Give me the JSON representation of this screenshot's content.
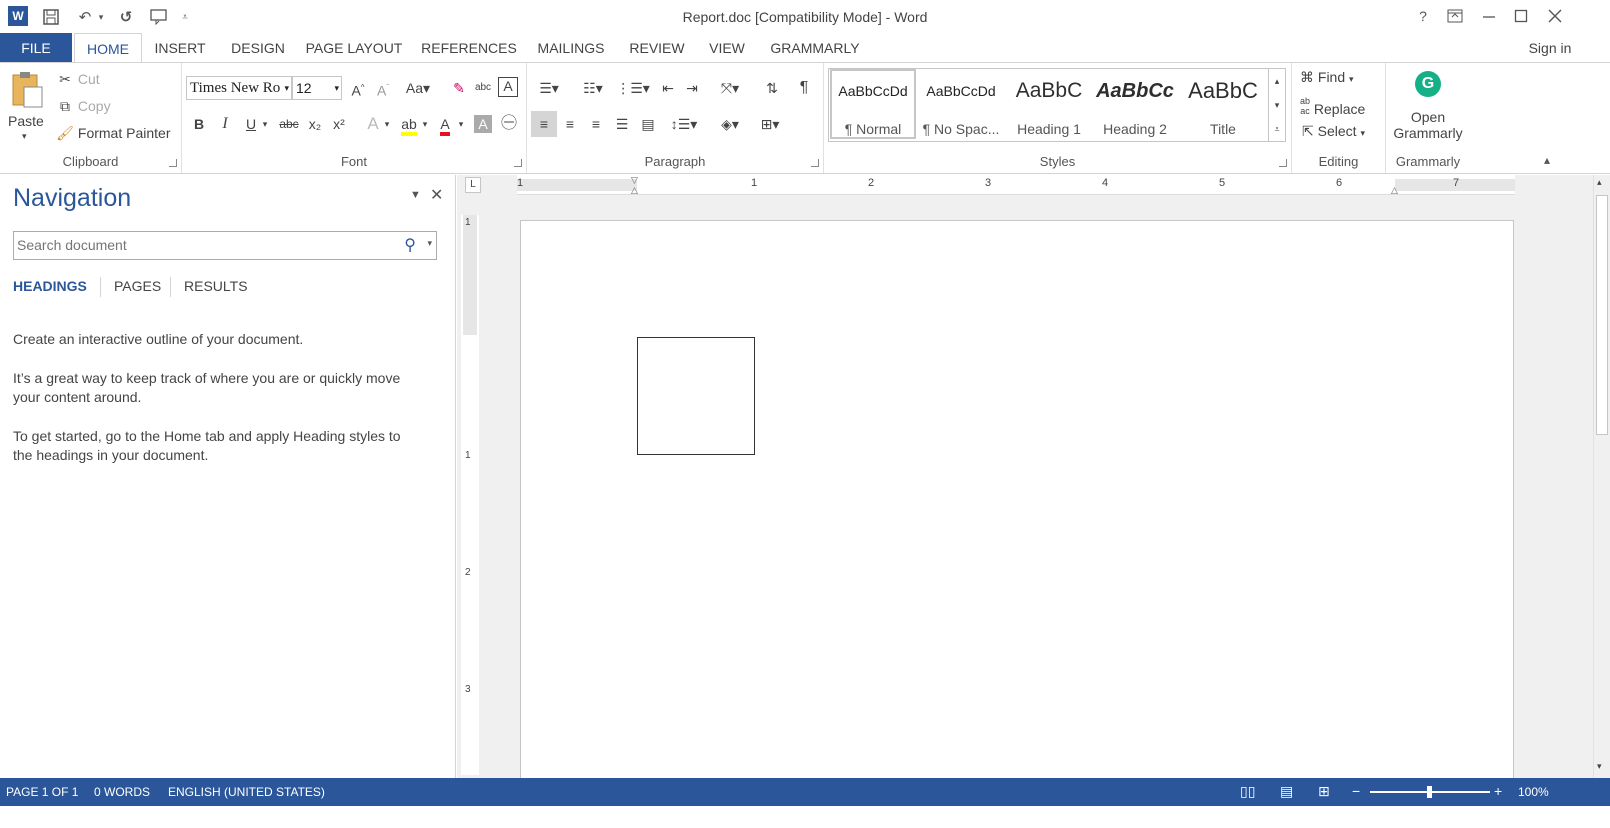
{
  "window": {
    "title": "Report.doc [Compatibility Mode] - Word",
    "help": "?",
    "sign_in": "Sign in"
  },
  "quick_access": {
    "icons": [
      "word-logo-icon",
      "save-icon",
      "undo-icon",
      "redo-icon",
      "touch-mode-icon",
      "customize-icon"
    ]
  },
  "tabs": [
    "FILE",
    "HOME",
    "INSERT",
    "DESIGN",
    "PAGE LAYOUT",
    "REFERENCES",
    "MAILINGS",
    "REVIEW",
    "VIEW",
    "GRAMMARLY"
  ],
  "active_tab": "HOME",
  "clipboard": {
    "label": "Clipboard",
    "paste": "Paste",
    "cut": "Cut",
    "copy": "Copy",
    "format_painter": "Format Painter"
  },
  "font": {
    "label": "Font",
    "name": "Times New Ro",
    "size": "12",
    "grow": "A",
    "case": "Aa",
    "bold": "B",
    "italic": "I",
    "underline": "U",
    "strike": "abc",
    "subscript": "x₂",
    "superscript": "x²",
    "effects": "A",
    "color": "A"
  },
  "paragraph": {
    "label": "Paragraph",
    "pilcrow": "¶"
  },
  "styles": {
    "label": "Styles",
    "items": [
      {
        "preview": "AaBbCcDd",
        "name": "¶ Normal"
      },
      {
        "preview": "AaBbCcDd",
        "name": "¶ No Spac..."
      },
      {
        "preview": "AaBbC",
        "name": "Heading 1"
      },
      {
        "preview": "AaBbCc",
        "name": "Heading 2"
      },
      {
        "preview": "AaBbC",
        "name": "Title"
      }
    ]
  },
  "editing": {
    "label": "Editing",
    "find": "Find",
    "replace": "Replace",
    "select": "Select"
  },
  "grammarly": {
    "label": "Grammarly",
    "open": "Open",
    "open2": "Grammarly"
  },
  "navigation": {
    "title": "Navigation",
    "search_placeholder": "Search document",
    "tabs": [
      "HEADINGS",
      "PAGES",
      "RESULTS"
    ],
    "para1": "Create an interactive outline of your document.",
    "para2a": "It’s a great way to keep track of where you are or quickly move",
    "para2b": "your content around.",
    "para3a": "To get started, go to the Home tab and apply Heading styles to",
    "para3b": "the headings in your document."
  },
  "ruler": {
    "h_ticks": [
      "1",
      "1",
      "2",
      "3",
      "4",
      "5",
      "6",
      "7"
    ],
    "v_ticks": [
      "1",
      "1",
      "2",
      "3"
    ],
    "tab_selector": "L"
  },
  "status": {
    "page": "PAGE 1 OF 1",
    "words": "0 WORDS",
    "language": "ENGLISH (UNITED STATES)",
    "zoom": "100%"
  }
}
